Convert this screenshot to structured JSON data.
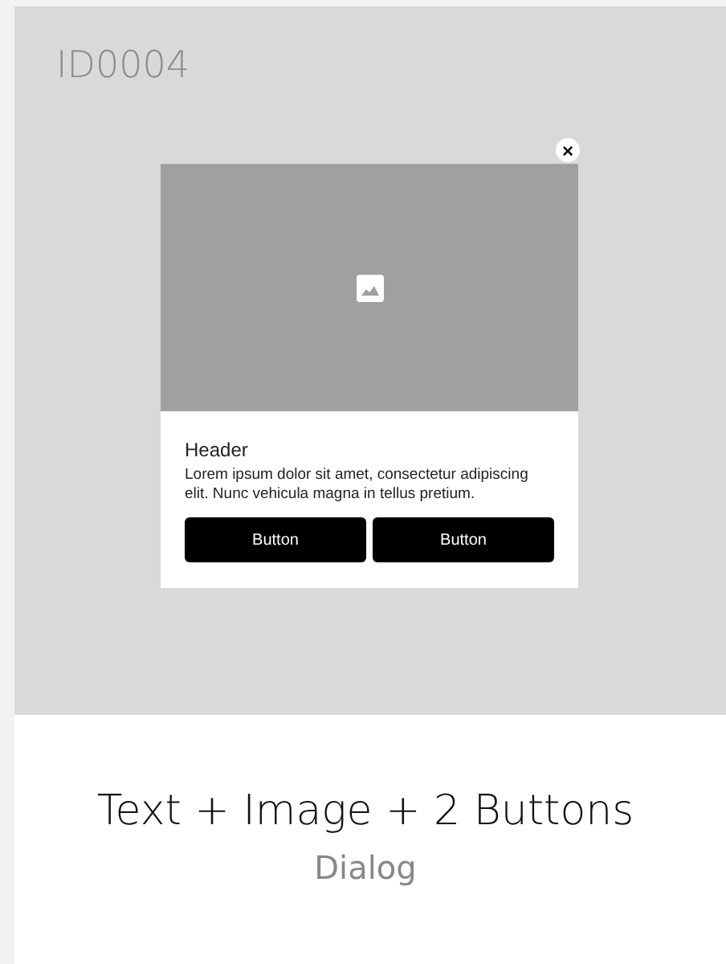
{
  "card": {
    "id": "ID0004",
    "title": "Text + Image + 2 Buttons",
    "category": "Dialog"
  },
  "dialog": {
    "close": "×",
    "header": "Header",
    "body": "Lorem ipsum dolor sit amet, consectetur adipiscing elit. Nunc vehicula magna in tellus pretium.",
    "buttons": [
      "Button",
      "Button"
    ]
  }
}
